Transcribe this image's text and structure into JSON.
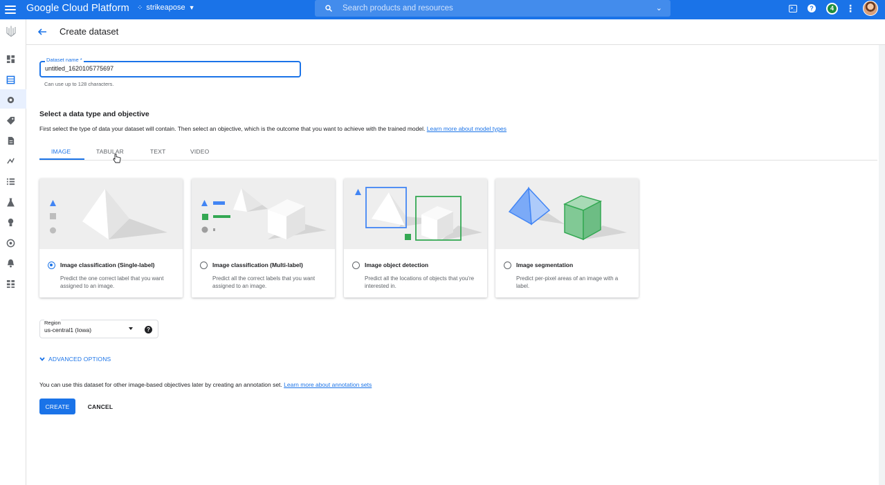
{
  "topbar": {
    "brand": "Google Cloud Platform",
    "project": "strikeapose",
    "search_placeholder": "Search products and resources",
    "badge_count": "4"
  },
  "page": {
    "title": "Create dataset"
  },
  "dataset_name": {
    "label": "Dataset name *",
    "value": "untitled_1620105775697",
    "hint": "Can use up to 128 characters."
  },
  "data_type": {
    "title": "Select a data type and objective",
    "description": "First select the type of data your dataset will contain. Then select an objective, which is the outcome that you want to achieve with the trained model.",
    "learn_more": "Learn more about model types"
  },
  "tabs": [
    {
      "label": "IMAGE",
      "active": true
    },
    {
      "label": "TABULAR",
      "active": false
    },
    {
      "label": "TEXT",
      "active": false
    },
    {
      "label": "VIDEO",
      "active": false
    }
  ],
  "objectives": [
    {
      "title": "Image classification (Single-label)",
      "desc": "Predict the one correct label that you want assigned to an image.",
      "selected": true
    },
    {
      "title": "Image classification (Multi-label)",
      "desc": "Predict all the correct labels that you want assigned to an image.",
      "selected": false
    },
    {
      "title": "Image object detection",
      "desc": "Predict all the locations of objects that you're interested in.",
      "selected": false
    },
    {
      "title": "Image segmentation",
      "desc": "Predict per-pixel areas of an image with a label.",
      "selected": false
    }
  ],
  "region": {
    "label": "Region",
    "value": "us-central1 (Iowa)"
  },
  "advanced_options": "ADVANCED OPTIONS",
  "note": {
    "text": "You can use this dataset for other image-based objectives later by creating an annotation set.",
    "link": "Learn more about annotation sets"
  },
  "actions": {
    "create": "CREATE",
    "cancel": "CANCEL"
  },
  "colors": {
    "primary": "#1a73e8",
    "green": "#34a853",
    "gray_bg": "#eeeeee"
  }
}
